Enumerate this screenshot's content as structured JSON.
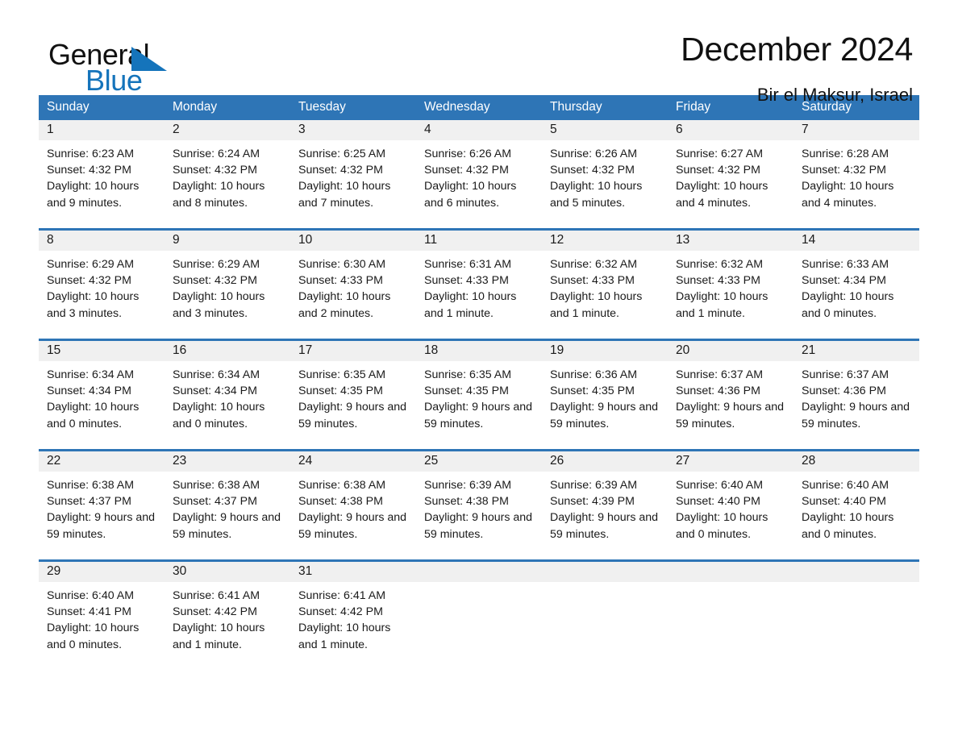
{
  "brand": {
    "name_part1": "General",
    "name_part2": "Blue",
    "triangle_icon": "triangle-icon",
    "accent_color": "#1574bb"
  },
  "header": {
    "title": "December 2024",
    "location": "Bir el Maksur, Israel"
  },
  "calendar": {
    "header_color": "#2e75b6",
    "daynum_bg": "#f0f0f0",
    "weekday_headers": [
      "Sunday",
      "Monday",
      "Tuesday",
      "Wednesday",
      "Thursday",
      "Friday",
      "Saturday"
    ],
    "weeks": [
      [
        {
          "day": "1",
          "sunrise": "Sunrise: 6:23 AM",
          "sunset": "Sunset: 4:32 PM",
          "daylight": "Daylight: 10 hours and 9 minutes."
        },
        {
          "day": "2",
          "sunrise": "Sunrise: 6:24 AM",
          "sunset": "Sunset: 4:32 PM",
          "daylight": "Daylight: 10 hours and 8 minutes."
        },
        {
          "day": "3",
          "sunrise": "Sunrise: 6:25 AM",
          "sunset": "Sunset: 4:32 PM",
          "daylight": "Daylight: 10 hours and 7 minutes."
        },
        {
          "day": "4",
          "sunrise": "Sunrise: 6:26 AM",
          "sunset": "Sunset: 4:32 PM",
          "daylight": "Daylight: 10 hours and 6 minutes."
        },
        {
          "day": "5",
          "sunrise": "Sunrise: 6:26 AM",
          "sunset": "Sunset: 4:32 PM",
          "daylight": "Daylight: 10 hours and 5 minutes."
        },
        {
          "day": "6",
          "sunrise": "Sunrise: 6:27 AM",
          "sunset": "Sunset: 4:32 PM",
          "daylight": "Daylight: 10 hours and 4 minutes."
        },
        {
          "day": "7",
          "sunrise": "Sunrise: 6:28 AM",
          "sunset": "Sunset: 4:32 PM",
          "daylight": "Daylight: 10 hours and 4 minutes."
        }
      ],
      [
        {
          "day": "8",
          "sunrise": "Sunrise: 6:29 AM",
          "sunset": "Sunset: 4:32 PM",
          "daylight": "Daylight: 10 hours and 3 minutes."
        },
        {
          "day": "9",
          "sunrise": "Sunrise: 6:29 AM",
          "sunset": "Sunset: 4:32 PM",
          "daylight": "Daylight: 10 hours and 3 minutes."
        },
        {
          "day": "10",
          "sunrise": "Sunrise: 6:30 AM",
          "sunset": "Sunset: 4:33 PM",
          "daylight": "Daylight: 10 hours and 2 minutes."
        },
        {
          "day": "11",
          "sunrise": "Sunrise: 6:31 AM",
          "sunset": "Sunset: 4:33 PM",
          "daylight": "Daylight: 10 hours and 1 minute."
        },
        {
          "day": "12",
          "sunrise": "Sunrise: 6:32 AM",
          "sunset": "Sunset: 4:33 PM",
          "daylight": "Daylight: 10 hours and 1 minute."
        },
        {
          "day": "13",
          "sunrise": "Sunrise: 6:32 AM",
          "sunset": "Sunset: 4:33 PM",
          "daylight": "Daylight: 10 hours and 1 minute."
        },
        {
          "day": "14",
          "sunrise": "Sunrise: 6:33 AM",
          "sunset": "Sunset: 4:34 PM",
          "daylight": "Daylight: 10 hours and 0 minutes."
        }
      ],
      [
        {
          "day": "15",
          "sunrise": "Sunrise: 6:34 AM",
          "sunset": "Sunset: 4:34 PM",
          "daylight": "Daylight: 10 hours and 0 minutes."
        },
        {
          "day": "16",
          "sunrise": "Sunrise: 6:34 AM",
          "sunset": "Sunset: 4:34 PM",
          "daylight": "Daylight: 10 hours and 0 minutes."
        },
        {
          "day": "17",
          "sunrise": "Sunrise: 6:35 AM",
          "sunset": "Sunset: 4:35 PM",
          "daylight": "Daylight: 9 hours and 59 minutes."
        },
        {
          "day": "18",
          "sunrise": "Sunrise: 6:35 AM",
          "sunset": "Sunset: 4:35 PM",
          "daylight": "Daylight: 9 hours and 59 minutes."
        },
        {
          "day": "19",
          "sunrise": "Sunrise: 6:36 AM",
          "sunset": "Sunset: 4:35 PM",
          "daylight": "Daylight: 9 hours and 59 minutes."
        },
        {
          "day": "20",
          "sunrise": "Sunrise: 6:37 AM",
          "sunset": "Sunset: 4:36 PM",
          "daylight": "Daylight: 9 hours and 59 minutes."
        },
        {
          "day": "21",
          "sunrise": "Sunrise: 6:37 AM",
          "sunset": "Sunset: 4:36 PM",
          "daylight": "Daylight: 9 hours and 59 minutes."
        }
      ],
      [
        {
          "day": "22",
          "sunrise": "Sunrise: 6:38 AM",
          "sunset": "Sunset: 4:37 PM",
          "daylight": "Daylight: 9 hours and 59 minutes."
        },
        {
          "day": "23",
          "sunrise": "Sunrise: 6:38 AM",
          "sunset": "Sunset: 4:37 PM",
          "daylight": "Daylight: 9 hours and 59 minutes."
        },
        {
          "day": "24",
          "sunrise": "Sunrise: 6:38 AM",
          "sunset": "Sunset: 4:38 PM",
          "daylight": "Daylight: 9 hours and 59 minutes."
        },
        {
          "day": "25",
          "sunrise": "Sunrise: 6:39 AM",
          "sunset": "Sunset: 4:38 PM",
          "daylight": "Daylight: 9 hours and 59 minutes."
        },
        {
          "day": "26",
          "sunrise": "Sunrise: 6:39 AM",
          "sunset": "Sunset: 4:39 PM",
          "daylight": "Daylight: 9 hours and 59 minutes."
        },
        {
          "day": "27",
          "sunrise": "Sunrise: 6:40 AM",
          "sunset": "Sunset: 4:40 PM",
          "daylight": "Daylight: 10 hours and 0 minutes."
        },
        {
          "day": "28",
          "sunrise": "Sunrise: 6:40 AM",
          "sunset": "Sunset: 4:40 PM",
          "daylight": "Daylight: 10 hours and 0 minutes."
        }
      ],
      [
        {
          "day": "29",
          "sunrise": "Sunrise: 6:40 AM",
          "sunset": "Sunset: 4:41 PM",
          "daylight": "Daylight: 10 hours and 0 minutes."
        },
        {
          "day": "30",
          "sunrise": "Sunrise: 6:41 AM",
          "sunset": "Sunset: 4:42 PM",
          "daylight": "Daylight: 10 hours and 1 minute."
        },
        {
          "day": "31",
          "sunrise": "Sunrise: 6:41 AM",
          "sunset": "Sunset: 4:42 PM",
          "daylight": "Daylight: 10 hours and 1 minute."
        },
        {
          "day": "",
          "sunrise": "",
          "sunset": "",
          "daylight": ""
        },
        {
          "day": "",
          "sunrise": "",
          "sunset": "",
          "daylight": ""
        },
        {
          "day": "",
          "sunrise": "",
          "sunset": "",
          "daylight": ""
        },
        {
          "day": "",
          "sunrise": "",
          "sunset": "",
          "daylight": ""
        }
      ]
    ]
  }
}
